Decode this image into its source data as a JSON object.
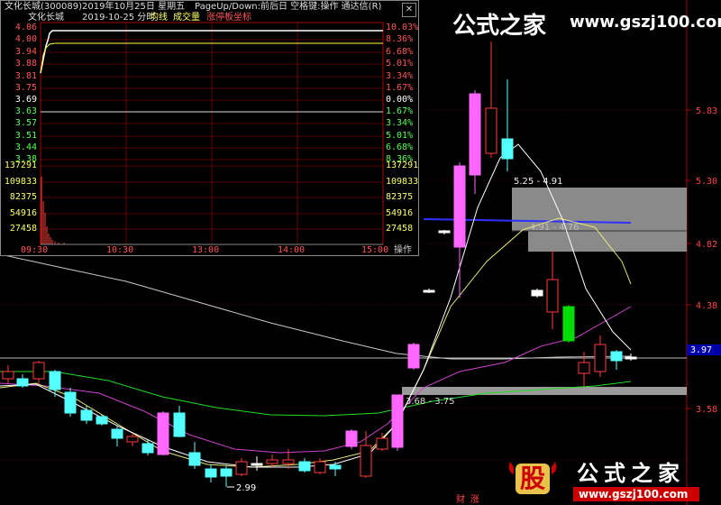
{
  "popup": {
    "header": {
      "stock": "文化长城(300089)",
      "date": "2019年10月25日 星期五",
      "hint": "PageUp/Down:前后日 空格键:操作 通达信(R)"
    },
    "subheader": {
      "name": "文化长城",
      "date_label": "2019-10-25 分时",
      "avg_label": "均线",
      "vol_label": "成交量",
      "limit_label": "涨停板坐标"
    },
    "price_labels": [
      "4.06",
      "4.00",
      "3.94",
      "3.88",
      "3.81",
      "3.75",
      "3.69",
      "3.63",
      "3.57",
      "3.51",
      "3.44",
      "3.38"
    ],
    "pct_labels": [
      "10.03%",
      "8.36%",
      "6.68%",
      "5.01%",
      "3.34%",
      "1.67%",
      "0.00%",
      "1.67%",
      "3.34%",
      "5.01%",
      "6.68%",
      "8.36%"
    ],
    "vol_labels": [
      "137291",
      "109833",
      "82375",
      "54916",
      "27458"
    ],
    "time_labels": [
      "09:30",
      "10:30",
      "13:00",
      "14:00",
      "15:00"
    ],
    "operate_button": "操作"
  },
  "main": {
    "right_axis": [
      "5.83",
      "5.30",
      "4.82",
      "4.38",
      "3.97",
      "3.58"
    ],
    "current_price_tag": "3.97",
    "box_high_label": "5.25 - 4.91",
    "box_high_label2": "4.91 - 4.76",
    "box_low_label": "3.68 - 3.75",
    "low_label": "2.99",
    "bottom_tabs": [
      "财",
      "涨"
    ]
  },
  "watermark": {
    "top_cn": "公式之家",
    "top_url": "www.gszj100.com",
    "bottom_logo_char": "股",
    "bottom_cn": "公式之家",
    "bottom_url": "www.gszj100.com"
  },
  "colors": {
    "up": "#ff3c3c",
    "down": "#54ffff",
    "limit_up": "#ff66ff",
    "volume_bar": "#ff3c3c",
    "avg_line": "#ffffff",
    "box_fill": "#8a8a8a",
    "blue_line": "#3030ff"
  }
}
